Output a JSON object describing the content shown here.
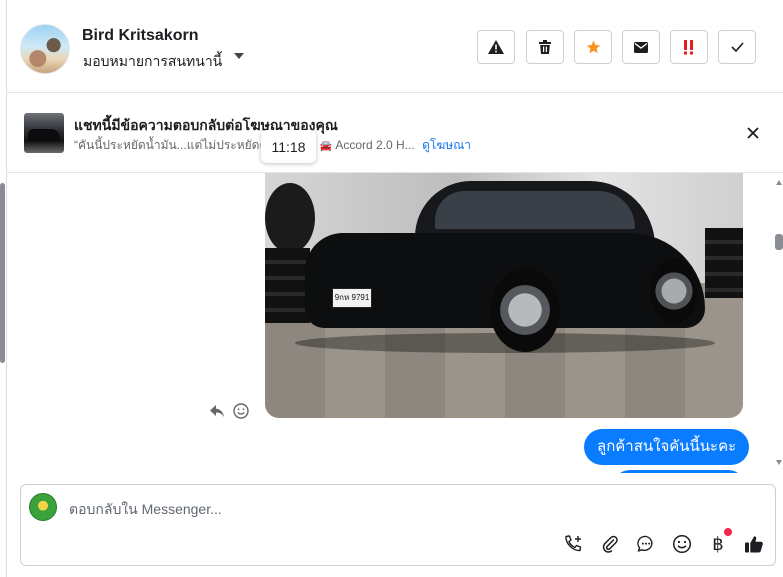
{
  "header": {
    "contact_name": "Bird Kritsakorn",
    "assign_label": "มอบหมายการสนทนานี้",
    "toolbar": [
      "report-spam",
      "delete",
      "star",
      "mark-unread",
      "important",
      "mark-done"
    ]
  },
  "banner": {
    "title": "แชทนี้มีข้อความตอบกลับต่อโฆษณาของคุณ",
    "quote": "“คันนี้ประหยัดน้ำมัน...แต่ไม่ประหยัดคว",
    "quote_end": "”",
    "car_emoji": "🚘",
    "ad_name": "Accord 2.0 H...",
    "view_ad": "ดูโฆษณา",
    "timestamp": "11:18"
  },
  "chat": {
    "photo_plate": "9กห 9791",
    "outgoing_message": "ลูกค้าสนใจคันนี้นะคะ"
  },
  "composer": {
    "placeholder": "ตอบกลับใน Messenger...",
    "baht_symbol": "฿",
    "icons": [
      "call-icon",
      "attachment-icon",
      "chat-bubble-icon",
      "emoji-icon",
      "payment-icon",
      "like-icon"
    ]
  },
  "colors": {
    "accent": "#0a7cff",
    "link": "#1877f2",
    "star": "#f7931e",
    "important": "#e02020",
    "notification_dot": "#f02849"
  }
}
